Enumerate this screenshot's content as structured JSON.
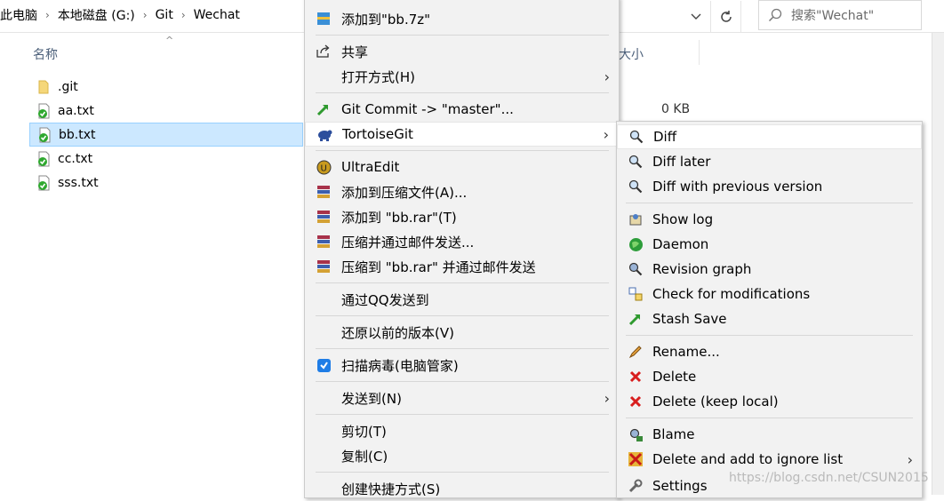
{
  "breadcrumb": [
    "此电脑",
    "本地磁盘 (G:)",
    "Git",
    "Wechat"
  ],
  "search": {
    "placeholder": "搜索\"Wechat\""
  },
  "columns": {
    "name": "名称",
    "size": "大小"
  },
  "files": [
    {
      "name": ".git",
      "icon": "folder-icon",
      "selected": false
    },
    {
      "name": "aa.txt",
      "icon": "git-clean-file-icon",
      "selected": false
    },
    {
      "name": "bb.txt",
      "icon": "git-clean-file-icon",
      "selected": true
    },
    {
      "name": "cc.txt",
      "icon": "git-clean-file-icon",
      "selected": false
    },
    {
      "name": "sss.txt",
      "icon": "git-clean-file-icon",
      "selected": false
    }
  ],
  "size_value": "0 KB",
  "context_menu": {
    "items": {
      "add_7z": "添加到\"bb.7z\"",
      "share": "共享",
      "open_with": "打开方式(H)",
      "git_commit": "Git Commit -> \"master\"...",
      "tortoisegit": "TortoiseGit",
      "ultraedit": "UltraEdit",
      "add_archive": "添加到压缩文件(A)...",
      "add_rar": "添加到 \"bb.rar\"(T)",
      "compress_email": "压缩并通过邮件发送...",
      "compress_rar_email": "压缩到 \"bb.rar\" 并通过邮件发送",
      "send_qq": "通过QQ发送到",
      "restore_prev": "还原以前的版本(V)",
      "scan_virus": "扫描病毒(电脑管家)",
      "send_to": "发送到(N)",
      "cut": "剪切(T)",
      "copy": "复制(C)",
      "create_shortcut": "创建快捷方式(S)"
    }
  },
  "tortoisegit_menu": {
    "items": {
      "diff": "Diff",
      "diff_later": "Diff later",
      "diff_prev": "Diff with previous version",
      "show_log": "Show log",
      "daemon": "Daemon",
      "revision_graph": "Revision graph",
      "check_mods": "Check for modifications",
      "stash_save": "Stash Save",
      "rename": "Rename...",
      "delete": "Delete",
      "delete_keep": "Delete (keep local)",
      "blame": "Blame",
      "delete_ignore": "Delete and add to ignore list",
      "settings": "Settings"
    }
  },
  "watermark": "https://blog.csdn.net/CSUN2015",
  "colors": {
    "selection": "#cce8ff",
    "menu_bg": "#f2f2f2",
    "header_text": "#4c607a"
  }
}
